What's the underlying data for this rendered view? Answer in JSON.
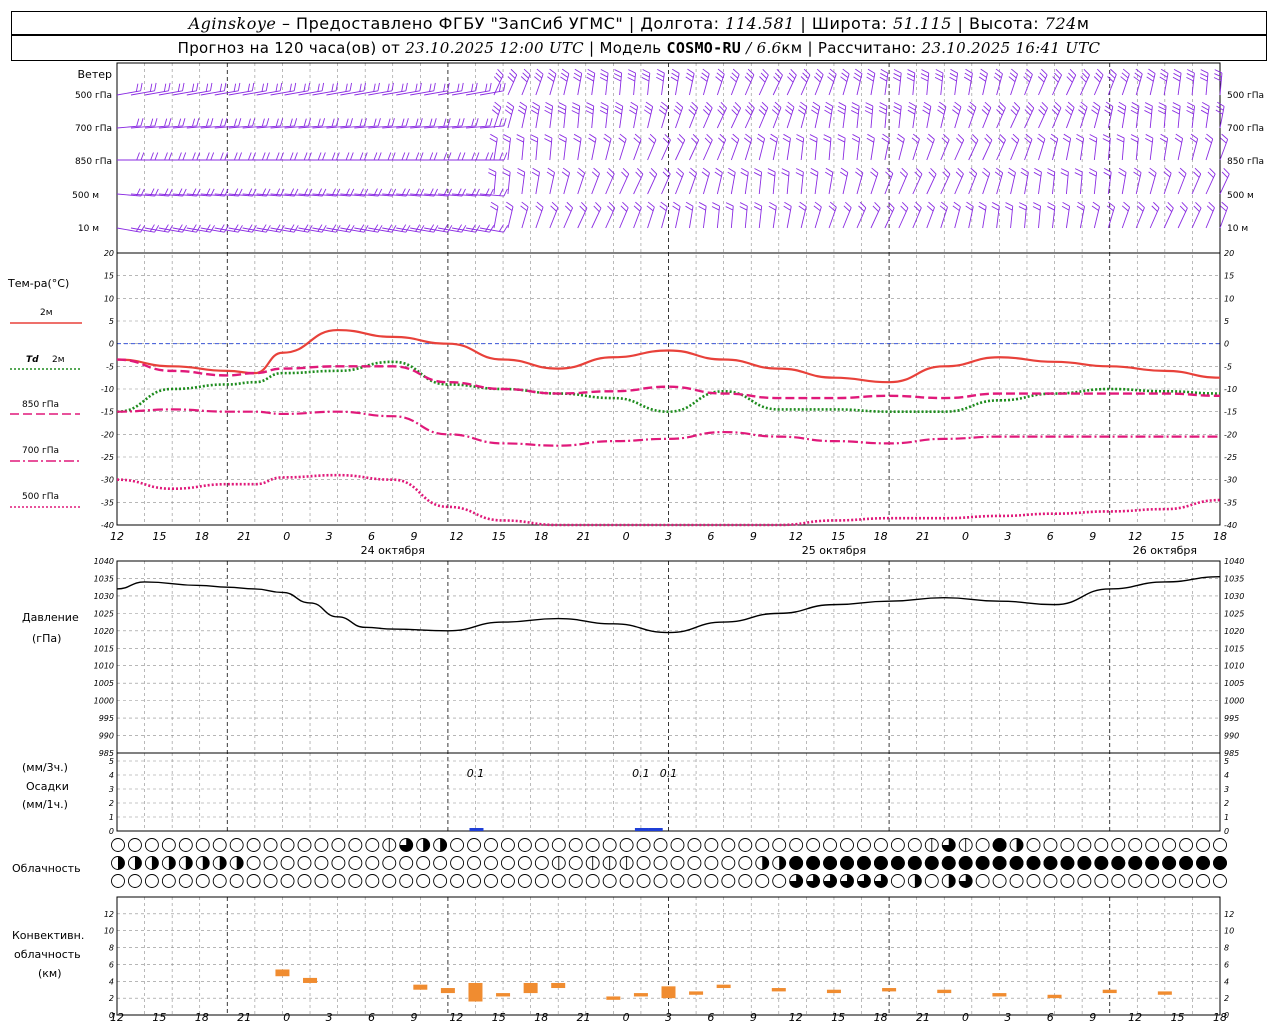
{
  "header": {
    "location": "Aginskoye",
    "provider": " – Предоставлено ФГБУ \"ЗапСиб УГМС\" | Долгота: ",
    "lon": "114.581",
    "lat_label": " | Широта: ",
    "lat": "51.115",
    "alt_label": " | Высота: ",
    "alt": "724",
    "alt_unit": "м",
    "forecast_label": "Прогноз на 120 часа(ов) от ",
    "forecast_from": "23.10.2025 12:00 UTC",
    "model_label": " | Модель ",
    "model": "COSMO-RU",
    "resolution": " / 6.6",
    "res_unit": "км",
    "calc_label": " | Рассчитано: ",
    "calc_time": "23.10.2025 16:41 UTC"
  },
  "colors": {
    "t2m": "#e8413a",
    "td2m": "#1e8c1e",
    "t850": "#e0197a",
    "t700": "#e0197a",
    "t500": "#e0197a",
    "pressure": "#000000",
    "wind": "#8a2be2",
    "precip": "#1f3fd6",
    "convective": "#f08c30",
    "zero_line": "#1f3fd6",
    "grid": "#8c8c8c"
  },
  "chart_data": [
    {
      "panel": "wind",
      "type": "other",
      "title": "Ветер",
      "levels": [
        "500 гПа",
        "700 гПа",
        "850 гПа",
        "500 м",
        "10 м"
      ],
      "note_directions": "wind barbs per 1.5h step at five levels"
    },
    {
      "panel": "temperature",
      "type": "line",
      "title": "Тем-ра(°C)",
      "ylim": [
        -40,
        20
      ],
      "yticks": [
        20,
        15,
        10,
        5,
        0,
        -5,
        -10,
        -15,
        -20,
        -25,
        -30,
        -35,
        -40
      ],
      "x_hours": [
        0,
        6,
        12,
        15,
        18,
        24,
        30,
        36,
        42,
        48,
        54,
        60,
        66,
        72,
        78,
        84,
        90,
        96,
        102,
        108,
        114,
        120
      ],
      "series": [
        {
          "name": "2м",
          "key": "t2m",
          "style": "solid",
          "values": [
            -3.5,
            -5,
            -6,
            -6.5,
            -2,
            3,
            1.5,
            0,
            -3.5,
            -5.5,
            -3,
            -1.5,
            -3.5,
            -5.5,
            -7.5,
            -8.5,
            -5,
            -3,
            -4,
            -5,
            -6,
            -7.5
          ]
        },
        {
          "name": "Td 2м",
          "key": "td2m",
          "style": "dotted",
          "values": [
            -15,
            -10,
            -9,
            -8.5,
            -6.5,
            -6,
            -4,
            -9,
            -10,
            -11,
            -12,
            -15,
            -10.5,
            -14.5,
            -14.5,
            -15,
            -15,
            -12.5,
            -11,
            -10,
            -10.5,
            -11
          ]
        },
        {
          "name": "850 гПа",
          "key": "t850",
          "style": "dash",
          "values": [
            -3.5,
            -6,
            -7,
            -6.5,
            -5.5,
            -5,
            -5,
            -8.5,
            -10,
            -11,
            -10.5,
            -9.5,
            -11,
            -12,
            -12,
            -11.5,
            -12,
            -11,
            -11,
            -11,
            -11,
            -11.5
          ]
        },
        {
          "name": "700 гПа",
          "key": "t700",
          "style": "dashdot",
          "values": [
            -15,
            -14.5,
            -15,
            -15,
            -15.5,
            -15,
            -16,
            -20,
            -22,
            -22.5,
            -21.5,
            -21,
            -19.5,
            -20.5,
            -21.5,
            -22,
            -21,
            -20.5,
            -20.5,
            -20.5,
            -20.5,
            -20.5
          ]
        },
        {
          "name": "500 гПа",
          "key": "t500",
          "style": "dot",
          "values": [
            -30,
            -32,
            -31,
            -31,
            -29.5,
            -29,
            -30,
            -36,
            -39,
            -43,
            -43,
            -40,
            -40.5,
            -40,
            -39,
            -38.5,
            -38.5,
            -38,
            -37.5,
            -37,
            -36.5,
            -34.5
          ]
        }
      ]
    },
    {
      "panel": "pressure",
      "type": "line",
      "title": "Давление",
      "ylabel": "(гПа)",
      "ylim": [
        985,
        1040
      ],
      "yticks": [
        1040,
        1035,
        1030,
        1025,
        1020,
        1015,
        1010,
        1005,
        1000,
        995,
        990,
        985
      ],
      "x_hours": [
        0,
        3,
        9,
        12,
        15,
        18,
        21,
        24,
        27,
        30,
        36,
        42,
        48,
        54,
        60,
        66,
        72,
        78,
        84,
        90,
        96,
        102,
        108,
        114,
        120
      ],
      "values": [
        1032,
        1034,
        1033,
        1032.5,
        1032,
        1031,
        1028,
        1024,
        1021,
        1020.5,
        1020,
        1022.5,
        1023.5,
        1022,
        1019.5,
        1022.5,
        1025,
        1027.5,
        1028.5,
        1029.5,
        1028.5,
        1027.5,
        1032,
        1034,
        1035.5
      ]
    },
    {
      "panel": "precipitation",
      "type": "bar",
      "title": "Осадки",
      "ylabel_top": "(мм/3ч.)",
      "ylabel_bottom": "(мм/1ч.)",
      "ylim": [
        0,
        5
      ],
      "yticks": [
        5,
        4,
        3,
        2,
        1,
        0
      ],
      "labels": [
        {
          "hour": 39,
          "text": "0.1"
        },
        {
          "hour": 57,
          "text": "0.1"
        },
        {
          "hour": 60,
          "text": "0.1"
        }
      ],
      "bars": [
        {
          "hour": 39,
          "value": 0.1
        },
        {
          "hour": 57,
          "value": 0.1
        },
        {
          "hour": 58.5,
          "value": 0.1
        }
      ]
    },
    {
      "panel": "cloudiness",
      "type": "other",
      "title": "Облачность",
      "rows": [
        "0000000000000000132200000000000000000000000000001310420000000000000000000000000000",
        "22222222000000000000000000101110000000224444444444444444444444444444444222444440000",
        "00000000000000000000000000000000000000003333330202300000000000000000002222222200000"
      ]
    },
    {
      "panel": "convective",
      "type": "bar",
      "title": "Конвективн. облачность",
      "ylabel": "(км)",
      "ylim": [
        0,
        14
      ],
      "yticks": [
        12,
        10,
        8,
        6,
        4,
        2,
        0
      ],
      "segments": [
        {
          "hour": 18,
          "bottom": 4.6,
          "top": 5.4
        },
        {
          "hour": 21,
          "bottom": 3.8,
          "top": 4.4
        },
        {
          "hour": 33,
          "bottom": 3.0,
          "top": 3.6
        },
        {
          "hour": 36,
          "bottom": 2.6,
          "top": 3.2
        },
        {
          "hour": 39,
          "bottom": 1.6,
          "top": 3.8
        },
        {
          "hour": 42,
          "bottom": 2.2,
          "top": 2.6
        },
        {
          "hour": 45,
          "bottom": 2.6,
          "top": 3.8
        },
        {
          "hour": 48,
          "bottom": 3.2,
          "top": 3.8
        },
        {
          "hour": 54,
          "bottom": 1.8,
          "top": 2.2
        },
        {
          "hour": 57,
          "bottom": 2.2,
          "top": 2.6
        },
        {
          "hour": 60,
          "bottom": 2.0,
          "top": 3.4
        },
        {
          "hour": 63,
          "bottom": 2.4,
          "top": 2.8
        },
        {
          "hour": 66,
          "bottom": 3.2,
          "top": 3.6
        },
        {
          "hour": 72,
          "bottom": 2.8,
          "top": 3.2
        },
        {
          "hour": 78,
          "bottom": 2.6,
          "top": 3.0
        },
        {
          "hour": 84,
          "bottom": 2.8,
          "top": 3.2
        },
        {
          "hour": 90,
          "bottom": 2.6,
          "top": 3.0
        },
        {
          "hour": 96,
          "bottom": 2.2,
          "top": 2.6
        },
        {
          "hour": 102,
          "bottom": 2.0,
          "top": 2.4
        },
        {
          "hour": 108,
          "bottom": 2.6,
          "top": 3.0
        },
        {
          "hour": 114,
          "bottom": 2.4,
          "top": 2.8
        }
      ]
    }
  ],
  "x_axis": {
    "hour_ticks": [
      "12",
      "15",
      "18",
      "21",
      "0",
      "3",
      "6",
      "9",
      "12",
      "15",
      "18",
      "21",
      "0",
      "3",
      "6",
      "9",
      "12",
      "15",
      "18",
      "21",
      "0",
      "3",
      "6",
      "9",
      "12",
      "15",
      "18"
    ],
    "dates": [
      {
        "hour": 30,
        "text": "24 октября"
      },
      {
        "hour": 78,
        "text": "25 октября"
      },
      {
        "hour": 114,
        "text": "26 октября"
      }
    ]
  },
  "labels": {
    "wind_title": "Ветер",
    "wind_levels": [
      "500 гПа",
      "700 гПа",
      "850 гПа",
      "500 м",
      "10 м"
    ],
    "temp_title": "Тем-ра(°C)",
    "legend_2m": "2м",
    "legend_td": "Td",
    "legend_td_2m": "2м",
    "legend_850": "850 гПа",
    "legend_700": "700 гПа",
    "legend_500": "500 гПа",
    "pressure_title": "Давление",
    "pressure_unit": "(гПа)",
    "precip_unit_top": "(мм/3ч.)",
    "precip_title": "Осадки",
    "precip_unit_bottom": "(мм/1ч.)",
    "cloud_title": "Облачность",
    "conv_title_1": "Конвективн.",
    "conv_title_2": "облачность",
    "conv_unit": "(км)"
  }
}
